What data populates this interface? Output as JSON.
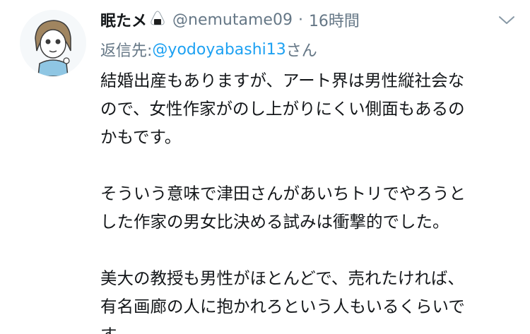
{
  "tweet": {
    "display_name": "眠たメ",
    "name_emoji": "rice-ball-emoji",
    "handle": "@nemutame09",
    "separator": "·",
    "timestamp": "16時間",
    "menu_icon": "chevron-down-icon",
    "reply_prefix": "返信先: ",
    "reply_handle": "@yodoyabashi13",
    "reply_suffix": "さん",
    "paragraphs": [
      {
        "lines": [
          "結婚出産もありますが、アート界は男性縦社会な",
          "ので、女性作家がのし上がりにくい側面もあるの",
          "かもです。"
        ]
      },
      {
        "lines": [
          "そういう意味で津田さんがあいちトリでやろうと",
          "した作家の男女比決める試みは衝撃的でした。"
        ]
      },
      {
        "lines": [
          "美大の教授も男性がほとんどで、売れたければ、",
          "有名画廊の人に抱かれろという人もいるくらいで",
          "す。"
        ]
      }
    ]
  },
  "colors": {
    "text": "#14171a",
    "secondary": "#657786",
    "link": "#1da1f2",
    "background": "#ffffff"
  }
}
